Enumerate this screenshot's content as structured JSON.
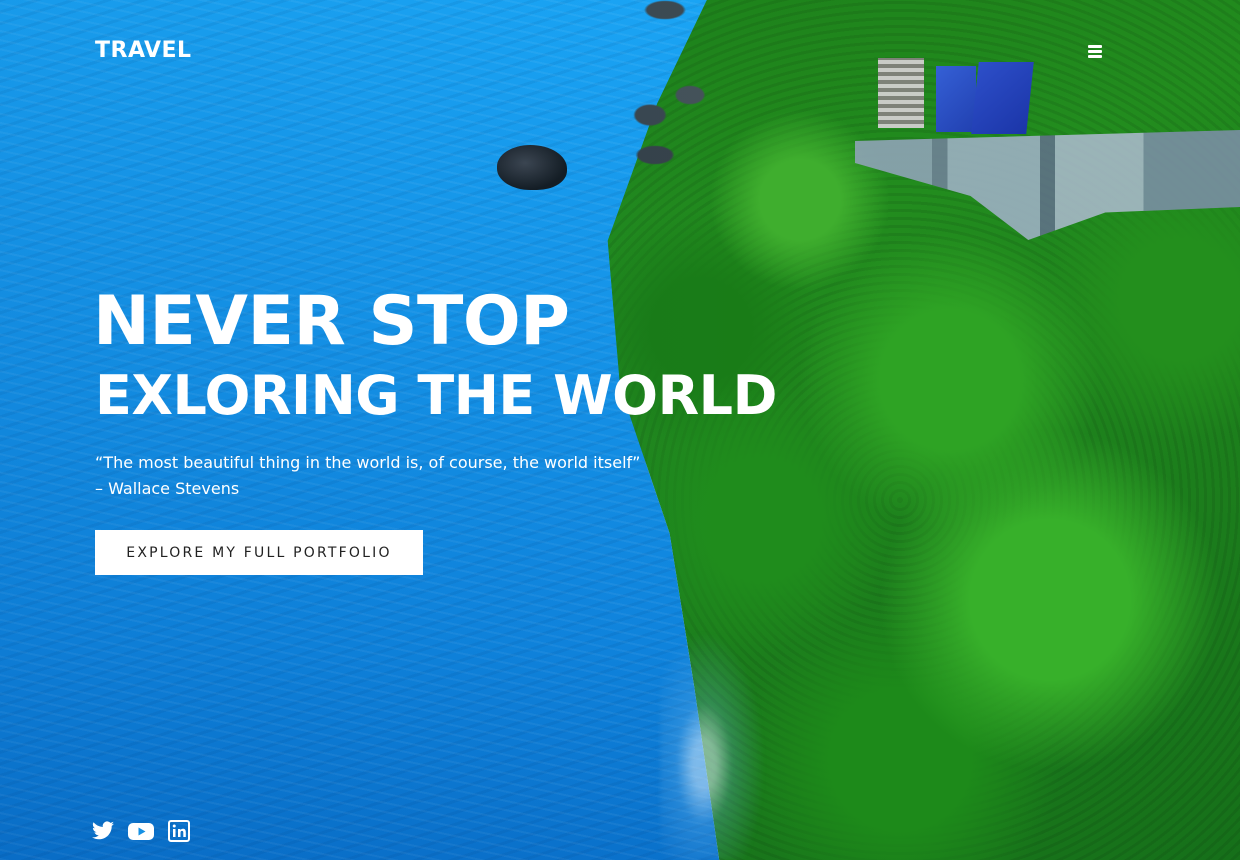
{
  "header": {
    "logo": "TRAVEL",
    "menu_icon": "hamburger-menu-icon"
  },
  "hero": {
    "headline_line1": "NEVER STOP",
    "headline_line2": "EXLORING THE WORLD",
    "quote_text": "“The most beautiful thing in the world is, of course, the world itself”",
    "quote_author": "– Wallace Stevens",
    "cta_label": "EXPLORE MY FULL PORTFOLIO"
  },
  "social": {
    "icons": [
      "twitter-icon",
      "youtube-icon",
      "linkedin-icon"
    ]
  },
  "colors": {
    "text": "#ffffff",
    "button_bg": "#ffffff",
    "button_text": "#222222",
    "ocean": "#1a9ef0",
    "forest": "#228c1e"
  }
}
